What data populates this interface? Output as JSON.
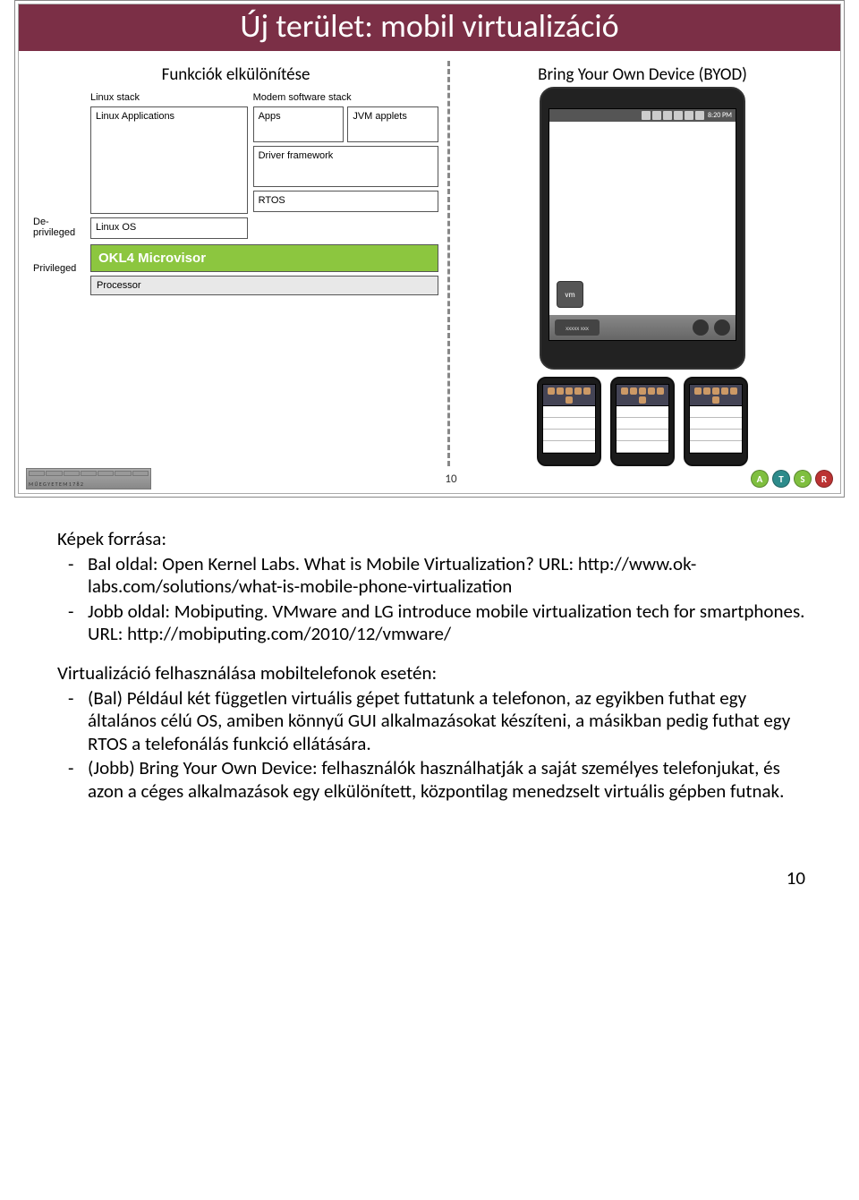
{
  "slide": {
    "title": "Új terület: mobil virtualizáció",
    "subtitle_left": "Funkciók elkülönítése",
    "subtitle_right": "Bring Your Own Device (BYOD)",
    "okl4": {
      "col_left_hdr": "Linux stack",
      "col_right_hdr": "Modem software stack",
      "linux_apps": "Linux Applications",
      "apps": "Apps",
      "jvm": "JVM applets",
      "driver": "Driver framework",
      "linux_os": "Linux OS",
      "rtos": "RTOS",
      "deprivileged": "De-privileged",
      "privileged": "Privileged",
      "microvisor": "OKL4 Microvisor",
      "processor": "Processor"
    },
    "phone": {
      "time": "8:20 PM",
      "widget": "vm",
      "dock_label": "xxxxx xxx"
    },
    "footer": {
      "uni": "M Ű E G Y E T E M   1 7 8 2",
      "page": "10",
      "badges": [
        "A",
        "T",
        "S",
        "R"
      ]
    }
  },
  "notes": {
    "sources_hdr": "Képek forrása:",
    "src1": "Bal oldal: Open Kernel Labs. What is Mobile Virtualization? URL: http://www.ok-labs.com/solutions/what-is-mobile-phone-virtualization",
    "src2": "Jobb oldal: Mobiputing. VMware and LG introduce mobile virtualization tech for smartphones. URL: http://mobiputing.com/2010/12/vmware/",
    "use_hdr": "Virtualizáció felhasználása mobiltelefonok esetén:",
    "use1": "(Bal) Például két független virtuális gépet futtatunk a telefonon, az egyikben futhat egy általános célú OS, amiben könnyű GUI alkalmazásokat készíteni, a másikban pedig futhat egy RTOS a telefonálás funkció ellátására.",
    "use2": "(Jobb) Bring Your Own Device: felhasználók használhatják a saját személyes telefonjukat, és azon a céges alkalmazások egy elkülönített, központilag menedzselt virtuális gépben futnak."
  },
  "page_number": "10"
}
